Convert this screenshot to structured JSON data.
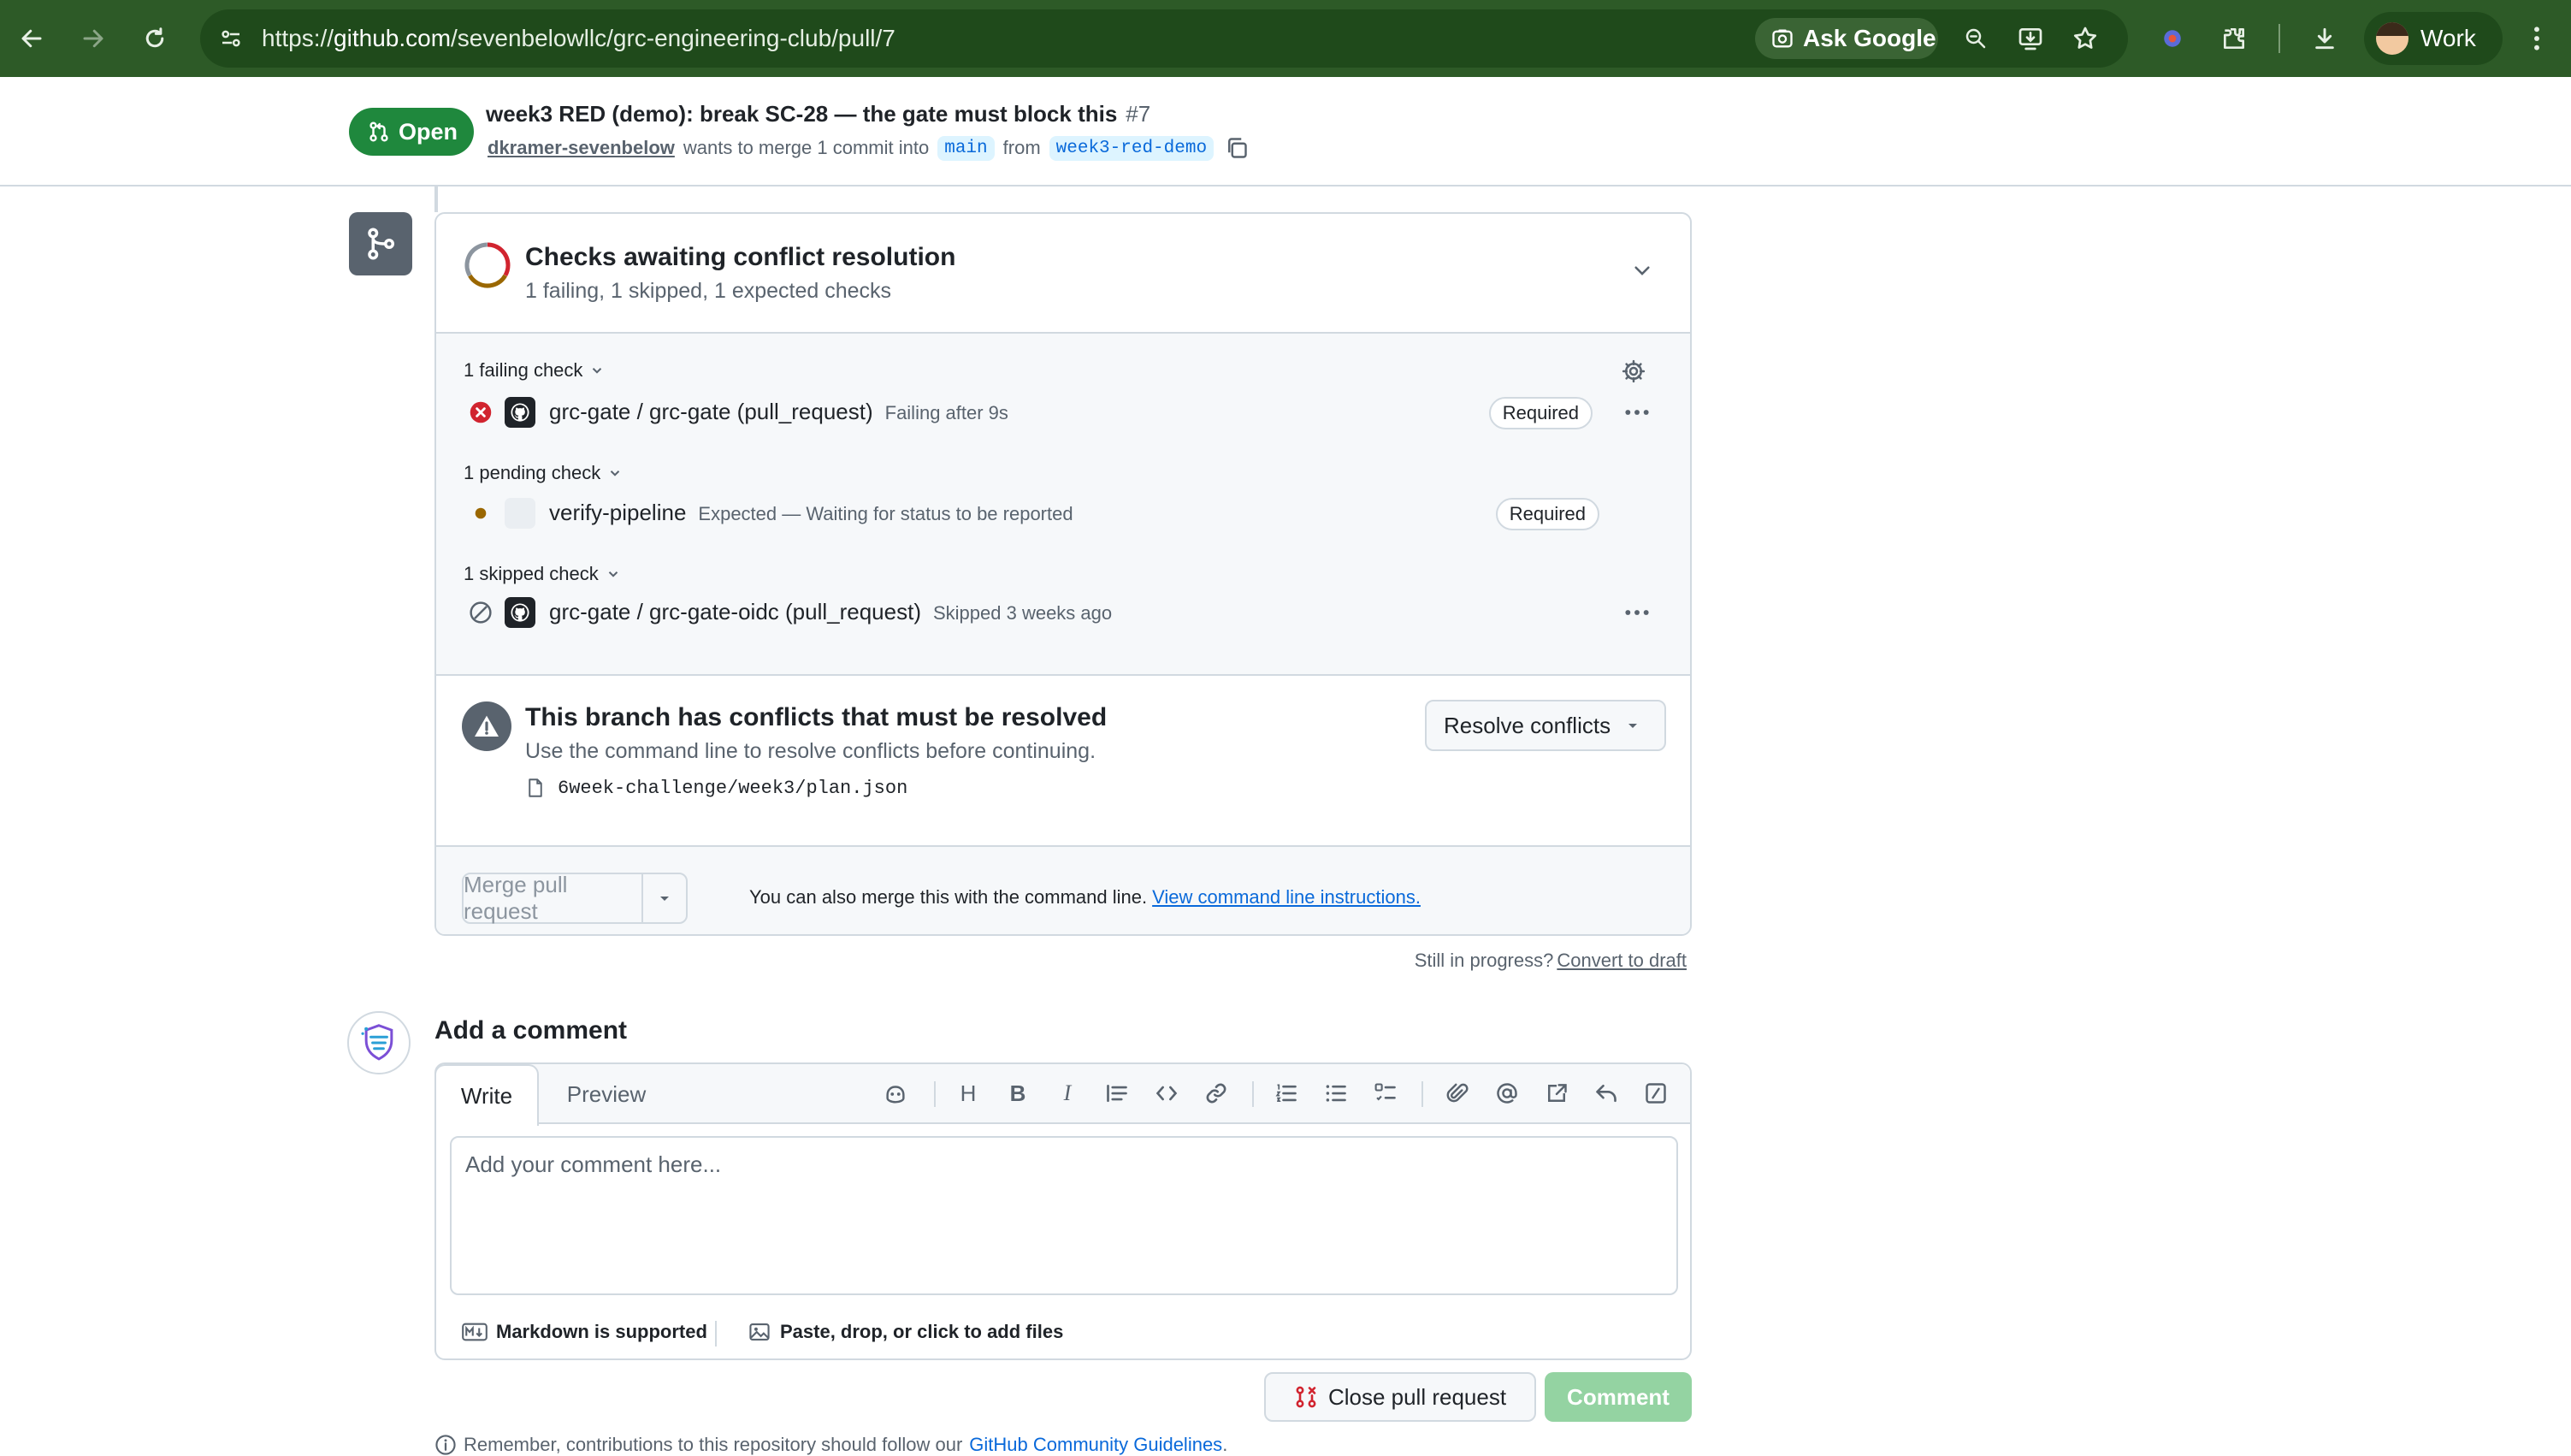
{
  "browser": {
    "url_prefix": "https://",
    "url_host": "github.com",
    "url_path": "/sevenbelowllc/grc-engineering-club/pull/7",
    "ask_google_label": "Ask Google",
    "profile_label": "Work",
    "chrome_bg": "#2d5a27"
  },
  "pr": {
    "state": "Open",
    "title": "week3 RED (demo): break SC-28 — the gate must block this",
    "number": "#7",
    "author": "dkramer-sevenbelow",
    "merge_text": "wants to merge 1 commit into",
    "base_branch": "main",
    "from_text": "from",
    "head_branch": "week3-red-demo"
  },
  "checks": {
    "title": "Checks awaiting conflict resolution",
    "summary": "1 failing, 1 skipped, 1 expected checks",
    "groups": [
      {
        "label": "1 failing check",
        "items": [
          {
            "name": "grc-gate / grc-gate (pull_request)",
            "description": "Failing after 9s",
            "badge": "Required",
            "status": "failure",
            "icon": "github-actions-icon"
          }
        ]
      },
      {
        "label": "1 pending check",
        "items": [
          {
            "name": "verify-pipeline",
            "description": "Expected — Waiting for status to be reported",
            "badge": "Required",
            "status": "pending",
            "icon": "placeholder-app-icon"
          }
        ]
      },
      {
        "label": "1 skipped check",
        "items": [
          {
            "name": "grc-gate / grc-gate-oidc (pull_request)",
            "description": "Skipped 3 weeks ago",
            "badge": "",
            "status": "skipped",
            "icon": "github-actions-icon"
          }
        ]
      }
    ]
  },
  "conflict": {
    "title": "This branch has conflicts that must be resolved",
    "subtitle": "Use the command line to resolve conflicts before continuing.",
    "file": "6week-challenge/week3/plan.json",
    "resolve_label": "Resolve conflicts"
  },
  "merge": {
    "button_label": "Merge pull request",
    "note": "You can also merge this with the command line.",
    "link": "View command line instructions."
  },
  "draft": {
    "prompt": "Still in progress?",
    "link": "Convert to draft"
  },
  "comment": {
    "heading": "Add a comment",
    "tab_write": "Write",
    "tab_preview": "Preview",
    "placeholder": "Add your comment here...",
    "markdown_note": "Markdown is supported",
    "attach_note": "Paste, drop, or click to add files",
    "close_label": "Close pull request",
    "submit_label": "Comment",
    "heading_tool_glyph": "H",
    "bold_tool_glyph": "B",
    "italic_tool_glyph": "I"
  },
  "footer": {
    "remember_text": "Remember, contributions to this repository should follow our",
    "guidelines_link": "GitHub Community Guidelines",
    "period": "."
  },
  "colors": {
    "open_green": "#1f883d",
    "failure_red": "#d1242f",
    "pending_amber": "#9a6700",
    "link_blue": "#0969da",
    "comment_disabled": "#94d3a2"
  }
}
